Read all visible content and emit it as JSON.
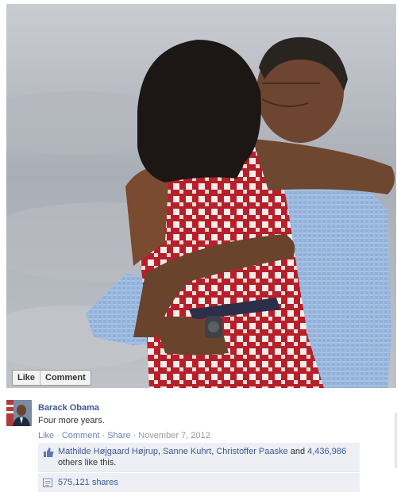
{
  "photo": {
    "alt_subject": "embrace",
    "like_label": "Like",
    "comment_label": "Comment"
  },
  "post": {
    "author": "Barack Obama",
    "message": "Four more years.",
    "actions": {
      "like": "Like",
      "comment": "Comment",
      "share": "Share",
      "date": "November 7, 2012",
      "separator": "·"
    },
    "likes": {
      "names": [
        "Mathilde Højgaard Højrup",
        "Sanne Kuhrt",
        "Christoffer Paaske"
      ],
      "and_word": "and",
      "count": "4,436,986",
      "suffix": "others like this."
    },
    "shares": {
      "text": "575,121 shares"
    }
  },
  "colors": {
    "link": "#3b5998",
    "ufi_bg": "#edeff4",
    "muted": "#999999"
  },
  "icons": {
    "like": "thumbs-up-icon",
    "share": "share-icon"
  }
}
